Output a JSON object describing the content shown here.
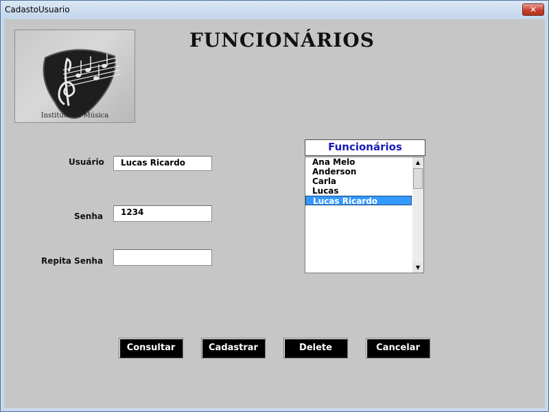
{
  "window": {
    "title": "CadastoUsuario",
    "close_label": "✕"
  },
  "logo": {
    "caption": "Instituto de Música"
  },
  "heading": "FUNCIONÁRIOS",
  "form": {
    "usuario_label": "Usuário",
    "usuario_value": "Lucas Ricardo",
    "senha_label": "Senha",
    "senha_value": "1234",
    "repita_label": "Repita Senha",
    "repita_value": ""
  },
  "listbox": {
    "header": "Funcionários",
    "items": [
      "Ana Melo",
      "Anderson",
      "Carla",
      "Lucas",
      "Lucas Ricardo"
    ],
    "selected_index": 4,
    "scroll_up": "▲",
    "scroll_down": "▼"
  },
  "buttons": {
    "consultar": "Consultar",
    "cadastrar": "Cadastrar",
    "delete": "Delete",
    "cancelar": "Cancelar"
  },
  "colors": {
    "list_header_text": "#1a1ab8",
    "selection": "#3399ff",
    "button_bg": "#000000",
    "form_bg": "#c6c6c6"
  }
}
